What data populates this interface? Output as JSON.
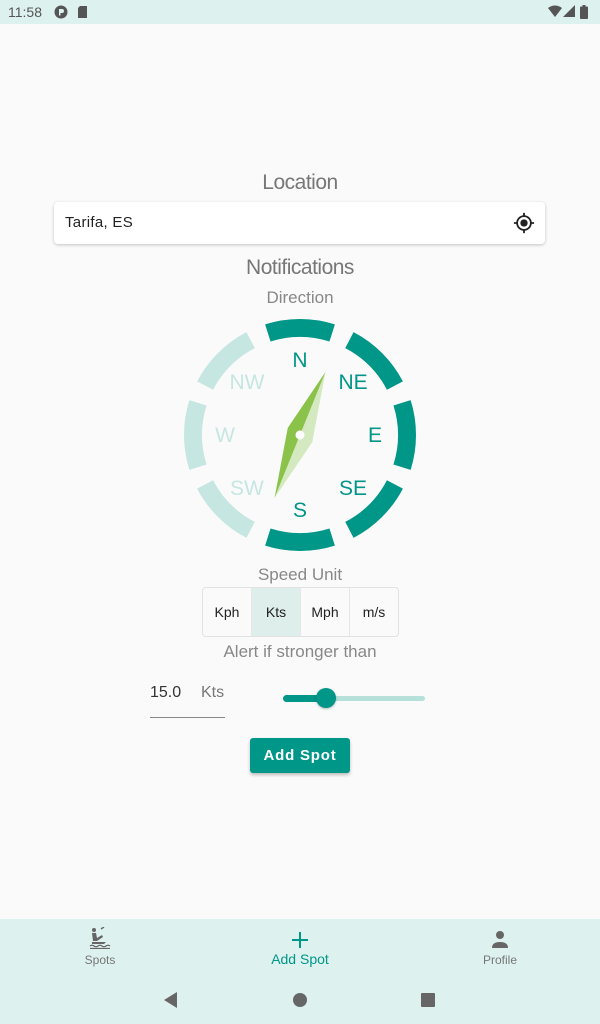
{
  "status_bar": {
    "time": "11:58",
    "left_icons": [
      "app-notification-icon",
      "sd-card-icon"
    ],
    "right_icons": [
      "wifi-icon",
      "cell-signal-icon",
      "battery-icon"
    ]
  },
  "location": {
    "heading": "Location",
    "value": "Tarifa, ES",
    "action_icon": "my-location-icon"
  },
  "notifications": {
    "heading": "Notifications",
    "direction_label": "Direction",
    "compass": {
      "directions": [
        {
          "label": "N",
          "selected": true
        },
        {
          "label": "NE",
          "selected": true
        },
        {
          "label": "E",
          "selected": true
        },
        {
          "label": "SE",
          "selected": true
        },
        {
          "label": "S",
          "selected": true
        },
        {
          "label": "SW",
          "selected": false
        },
        {
          "label": "W",
          "selected": false
        },
        {
          "label": "NW",
          "selected": false
        }
      ],
      "needle_heading_deg": 22,
      "colors": {
        "selected": "#009688",
        "unselected": "#c6e6e2",
        "needle_dark": "#8bc34a",
        "needle_light": "#d4e9c0"
      }
    },
    "speed_unit_label": "Speed Unit",
    "speed_units": [
      {
        "label": "Kph",
        "selected": false
      },
      {
        "label": "Kts",
        "selected": true
      },
      {
        "label": "Mph",
        "selected": false
      },
      {
        "label": "m/s",
        "selected": false
      }
    ],
    "alert_label": "Alert if stronger than",
    "threshold_value": "15.0",
    "threshold_unit": "Kts",
    "slider_fraction": 0.3
  },
  "add_spot_button": "Add Spot",
  "bottom_nav": {
    "items": [
      {
        "label": "Spots",
        "icon": "kitesurf-icon",
        "active": false
      },
      {
        "label": "Add Spot",
        "icon": "plus-icon",
        "active": true
      },
      {
        "label": "Profile",
        "icon": "person-icon",
        "active": false
      }
    ]
  },
  "system_nav": {
    "buttons": [
      "back",
      "home",
      "recents"
    ]
  },
  "colors": {
    "accent": "#009688",
    "bar_background": "#ddf1ee",
    "page_background": "#fafafa"
  }
}
